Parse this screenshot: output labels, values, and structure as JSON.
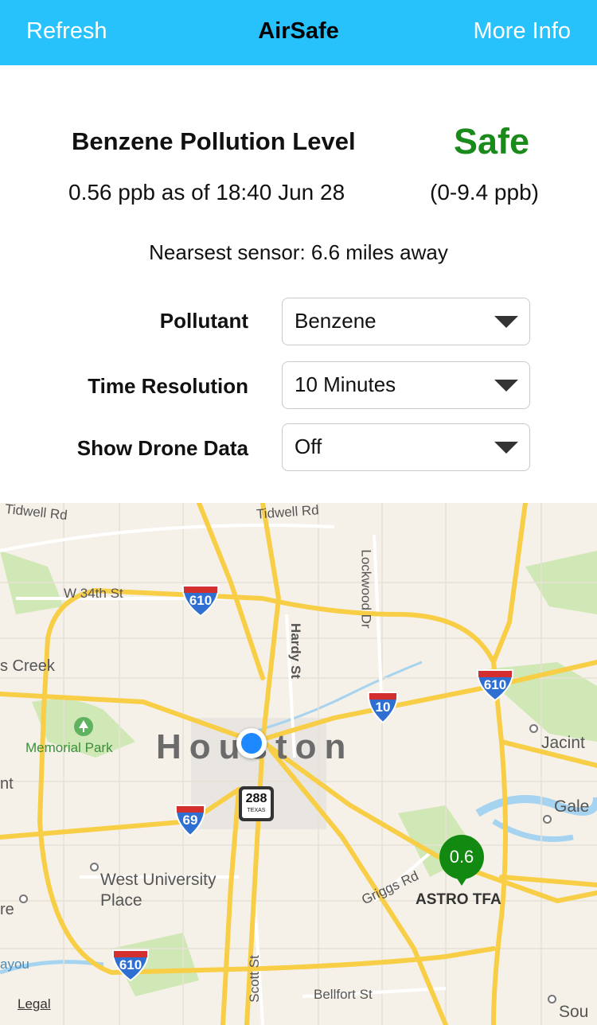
{
  "navbar": {
    "left_label": "Refresh",
    "title": "AirSafe",
    "right_label": "More Info"
  },
  "summary": {
    "title": "Benzene Pollution Level",
    "status": "Safe",
    "reading": "0.56 ppb as of 18:40 Jun 28",
    "safe_range": "(0-9.4 ppb)",
    "nearest_sensor": "Nearsest sensor: 6.6 miles away",
    "status_color": "#1a8a1a"
  },
  "form": {
    "pollutant": {
      "label": "Pollutant",
      "value": "Benzene"
    },
    "time_resolution": {
      "label": "Time Resolution",
      "value": "10 Minutes"
    },
    "drone_data": {
      "label": "Show Drone Data",
      "value": "Off"
    }
  },
  "map": {
    "city": "Houston",
    "sensor": {
      "value": "0.6",
      "name": "ASTRO TFA",
      "color": "#128a12"
    },
    "legal": "Legal",
    "labels": {
      "tidwell_left": "Tidwell Rd",
      "tidwell_right": "Tidwell Rd",
      "w34th": "W 34th St",
      "lockwood": "Lockwood Dr",
      "hardy": "Hardy St",
      "creek": "s Creek",
      "memorial": "Memorial Park",
      "jacinto": "Jacint",
      "galena": "Gale",
      "west_univ_1": "West University",
      "west_univ_2": "Place",
      "griggs": "Griggs Rd",
      "scott": "Scott St",
      "bellfort": "Bellfort St",
      "bayou": "ayou",
      "south": "Sou",
      "edge_nt": "nt",
      "edge_re": "re"
    },
    "shields": {
      "i610_north": "610",
      "i610_east": "610",
      "i610_south": "610",
      "i10": "10",
      "i69": "69",
      "tx288": "288",
      "tx288_sub": "TEXAS"
    },
    "colors": {
      "land": "#f5f1e8",
      "highway": "#f7ce46",
      "park": "#cfe8b5",
      "water": "#a6d3f0",
      "accent": "#27c2fb",
      "user_dot": "#1e88ff"
    }
  }
}
